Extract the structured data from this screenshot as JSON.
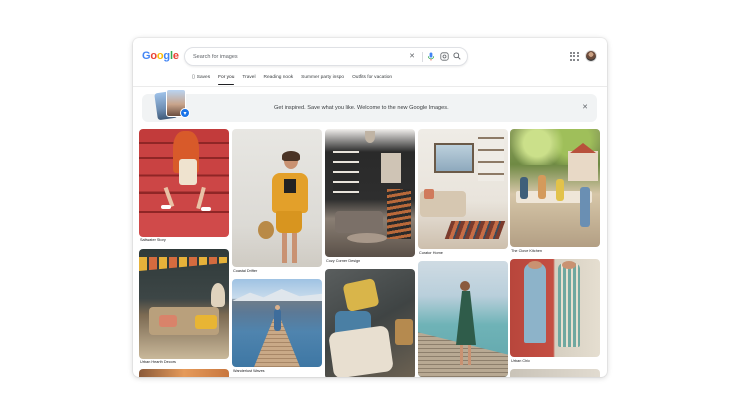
{
  "header": {
    "logo": [
      "G",
      "o",
      "o",
      "g",
      "l",
      "e"
    ],
    "logo_colors": [
      "#4285F4",
      "#EA4335",
      "#FBBC05",
      "#4285F4",
      "#34A853",
      "#EA4335"
    ],
    "search": {
      "placeholder": "Search for images",
      "icons": [
        "close-icon",
        "mic-icon",
        "lens-icon",
        "search-icon"
      ]
    },
    "apps_icon": "apps-grid-icon",
    "avatar": "user-avatar"
  },
  "tabs": [
    {
      "label": "Saves",
      "icon": "bookmark-icon",
      "active": false
    },
    {
      "label": "For you",
      "active": true
    },
    {
      "label": "Travel",
      "active": false
    },
    {
      "label": "Reading nook",
      "active": false
    },
    {
      "label": "Summer party inspo",
      "active": false
    },
    {
      "label": "Outfits for vacation",
      "active": false
    }
  ],
  "banner": {
    "text": "Get inspired. Save what you like. Welcome to the new Google Images.",
    "close_icon": "close-icon"
  },
  "grid": [
    [
      {
        "caption": "Saltwater Story"
      },
      {
        "caption": "Urban Hearth Decors"
      },
      {
        "caption": ""
      }
    ],
    [
      {
        "caption": "Coastal Drifter"
      },
      {
        "caption": "Wanderlust Waves"
      }
    ],
    [
      {
        "caption": "Cozy Corner Design"
      },
      {
        "caption": ""
      }
    ],
    [
      {
        "caption": "Curator Home"
      },
      {
        "caption": ""
      }
    ],
    [
      {
        "caption": "The Clove Kitchen"
      },
      {
        "caption": "Urban Chic"
      },
      {
        "caption": ""
      }
    ]
  ]
}
